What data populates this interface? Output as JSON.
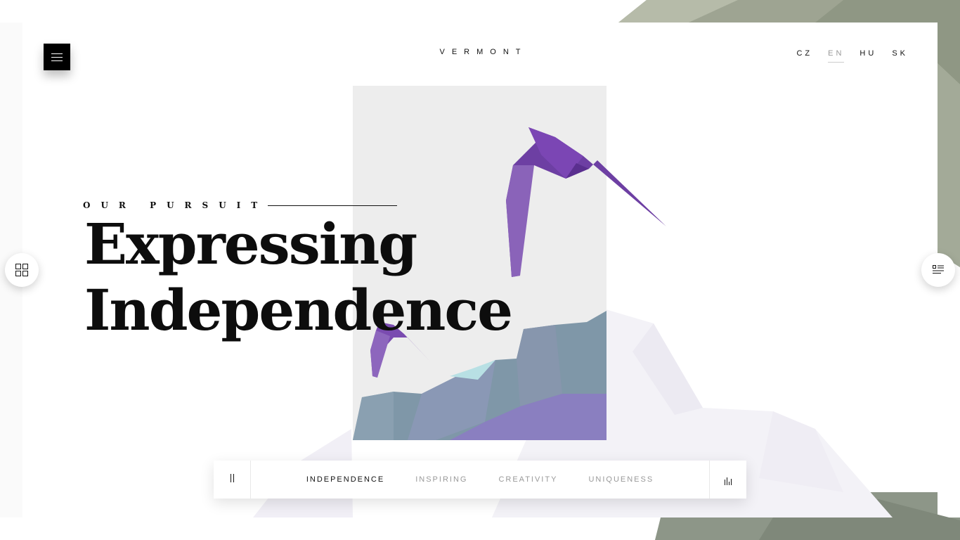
{
  "header": {
    "logo": "VERMONT",
    "languages": [
      {
        "code": "CZ",
        "active": false
      },
      {
        "code": "EN",
        "active": true
      },
      {
        "code": "HU",
        "active": false
      },
      {
        "code": "SK",
        "active": false
      }
    ]
  },
  "hero": {
    "kicker": "OUR PURSUIT",
    "title_line1": "Expressing",
    "title_line2": "Independence"
  },
  "slider": {
    "tabs": [
      {
        "label": "INDEPENDENCE",
        "active": true
      },
      {
        "label": "INSPIRING",
        "active": false
      },
      {
        "label": "CREATIVITY",
        "active": false
      },
      {
        "label": "UNIQUENESS",
        "active": false
      }
    ]
  },
  "icons": {
    "menu": "hamburger-icon",
    "left_side": "grid-icon",
    "right_side": "list-icon",
    "pause": "pause-icon",
    "sound": "sound-bars-icon"
  },
  "colors": {
    "accent_purple": "#7a4fb0",
    "rock_teal": "#7f9aa8",
    "bg_olive": "#9aa38f"
  }
}
